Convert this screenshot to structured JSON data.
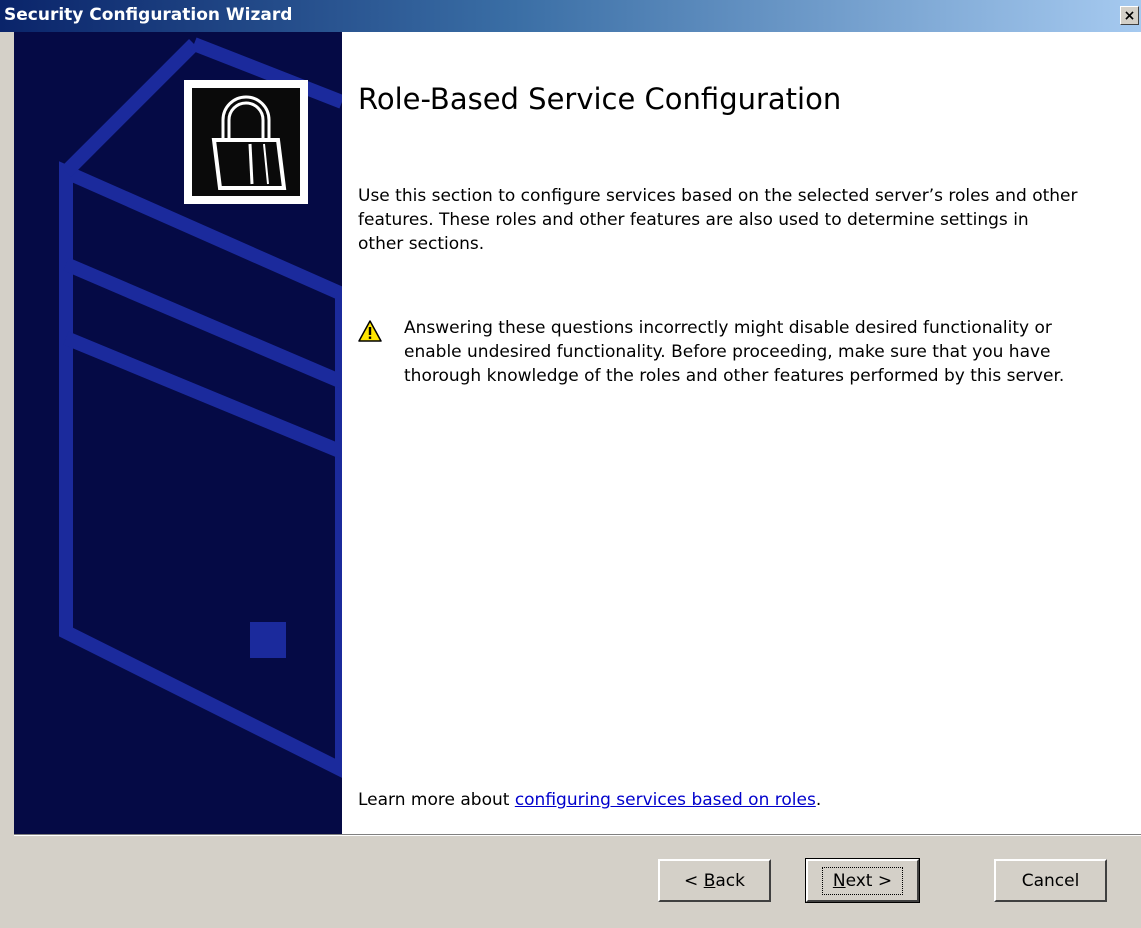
{
  "window": {
    "title": "Security Configuration Wizard",
    "close_label": "×"
  },
  "page": {
    "title": "Role-Based Service Configuration",
    "description": "Use this section to configure services based on the selected server’s roles and other features. These roles and other features are also used to determine settings in other sections.",
    "warning": "Answering these questions incorrectly might disable desired functionality or enable undesired functionality. Before proceeding, make sure that you have thorough knowledge of the roles and other features performed by this server.",
    "learn_more_prefix": "Learn more about ",
    "learn_more_link": "configuring services based on roles",
    "learn_more_suffix": "."
  },
  "buttons": {
    "back_prefix": "< ",
    "back_mnemonic": "B",
    "back_rest": "ack",
    "next_mnemonic": "N",
    "next_rest": "ext >",
    "cancel": "Cancel"
  },
  "colors": {
    "sidebar_bg": "#050a45",
    "sidebar_lines": "#1b2a9c",
    "link": "#0000cc",
    "titlebar_start": "#0a246a",
    "titlebar_end": "#a6caf0"
  },
  "icons": {
    "banner": "padlock-icon",
    "warning": "warning-icon",
    "close": "close-icon"
  }
}
